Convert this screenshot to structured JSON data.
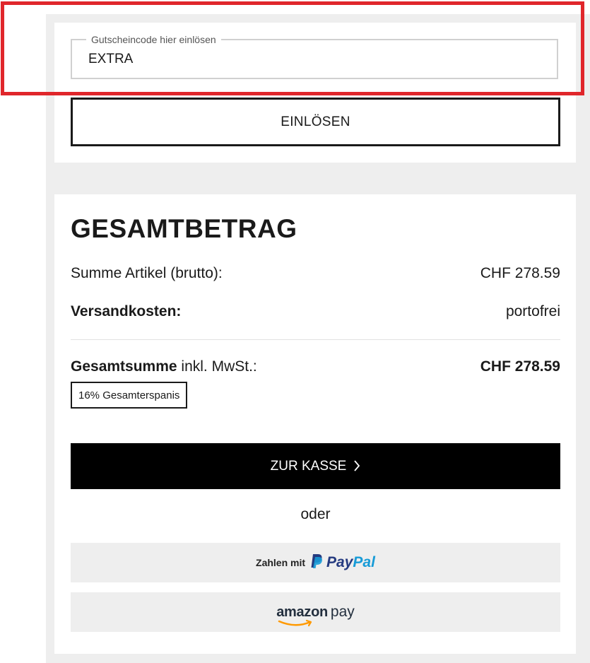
{
  "voucher": {
    "legend": "Gutscheincode hier einlösen",
    "value": "EXTRA",
    "redeem_label": "EINLÖSEN"
  },
  "summary": {
    "title": "GESAMTBETRAG",
    "subtotal_label": "Summe Artikel (brutto):",
    "subtotal_value": "CHF 278.59",
    "shipping_label": "Versandkosten:",
    "shipping_value": "portofrei",
    "total_label_bold": "Gesamtsumme",
    "total_label_rest": " inkl. MwSt.:",
    "total_value": "CHF 278.59",
    "savings_badge": "16% Gesamterspanis"
  },
  "checkout": {
    "button_label": "ZUR KASSE",
    "or_text": "oder"
  },
  "payment": {
    "paypal_prefix": "Zahlen mit",
    "paypal_word_pay": "Pay",
    "paypal_word_pal": "Pal",
    "amazon_word": "amazon",
    "amazon_pay": "pay"
  },
  "colors": {
    "highlight": "#e0262b",
    "panel_bg": "#eeeeee",
    "checkout_bg": "#000000",
    "paypal_dark": "#253b80",
    "paypal_light": "#179bd7",
    "amazon_orange": "#ff9900"
  },
  "icons": [
    "chevron-right-icon",
    "paypal-logo-icon",
    "amazon-smile-icon"
  ]
}
